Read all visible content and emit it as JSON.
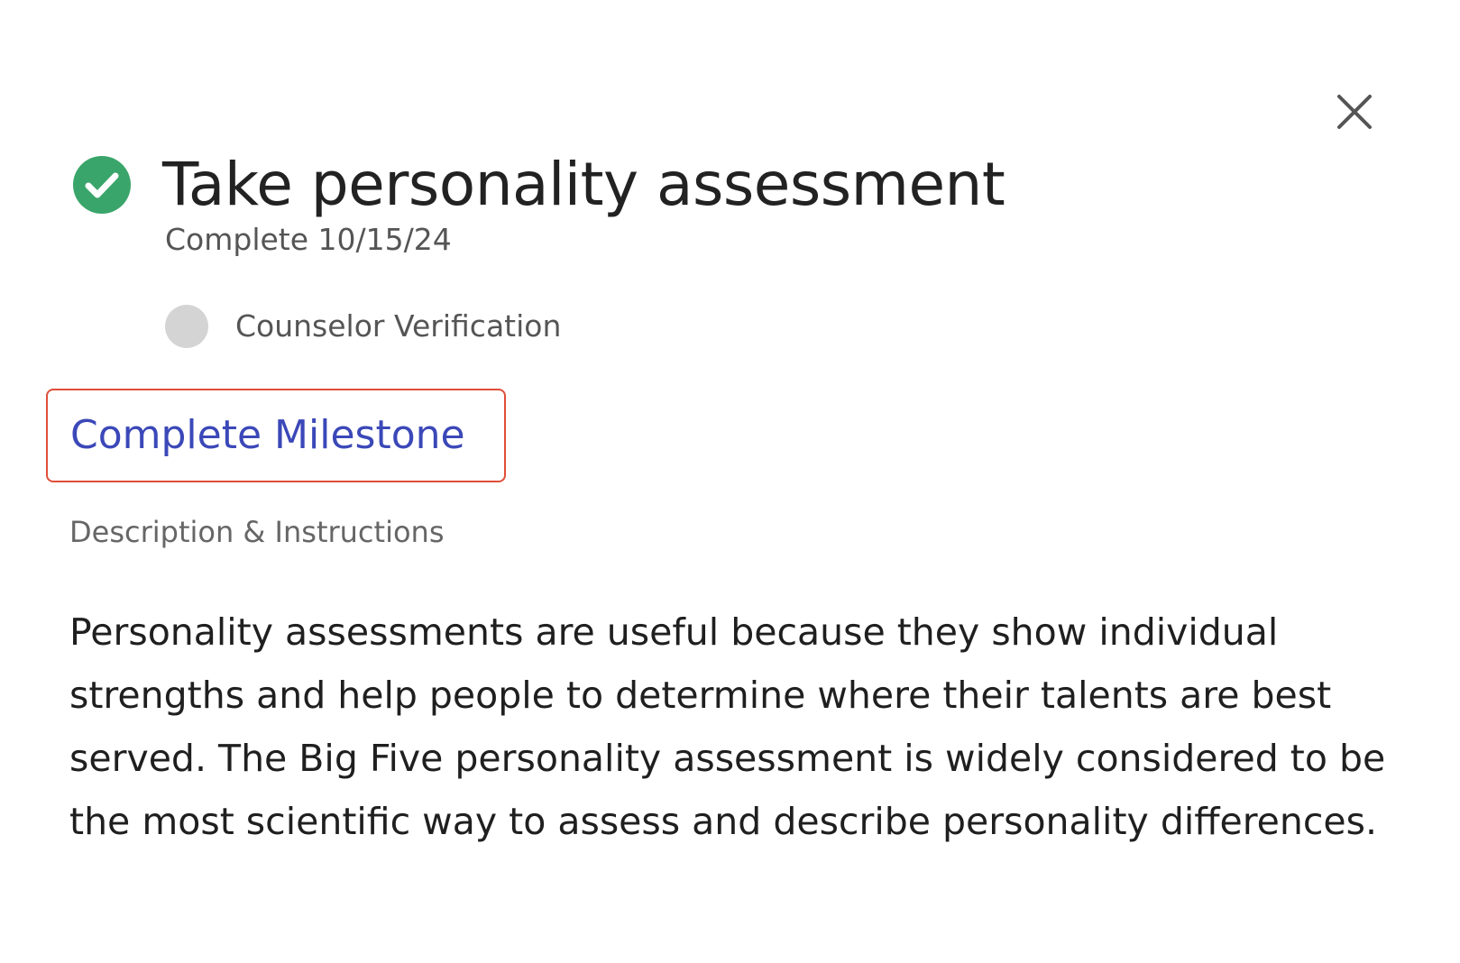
{
  "header": {
    "close_icon": "close-icon"
  },
  "milestone": {
    "title": "Take personality assessment",
    "status_icon": "check-circle-icon",
    "status_text": "Complete 10/15/24",
    "verification_label": "Counselor Verification",
    "complete_button_label": "Complete Milestone",
    "section_label": "Description & Instructions",
    "description": "Personality assessments are useful because they show individual strengths and help people to determine where their talents are best served. The Big Five personality assessment is widely considered to be the most scientific way to assess and describe personality differences."
  },
  "colors": {
    "success_green": "#3aa56a",
    "link_blue": "#3b48b8",
    "highlight_red": "#e04e39",
    "pending_gray": "#d4d4d4"
  }
}
